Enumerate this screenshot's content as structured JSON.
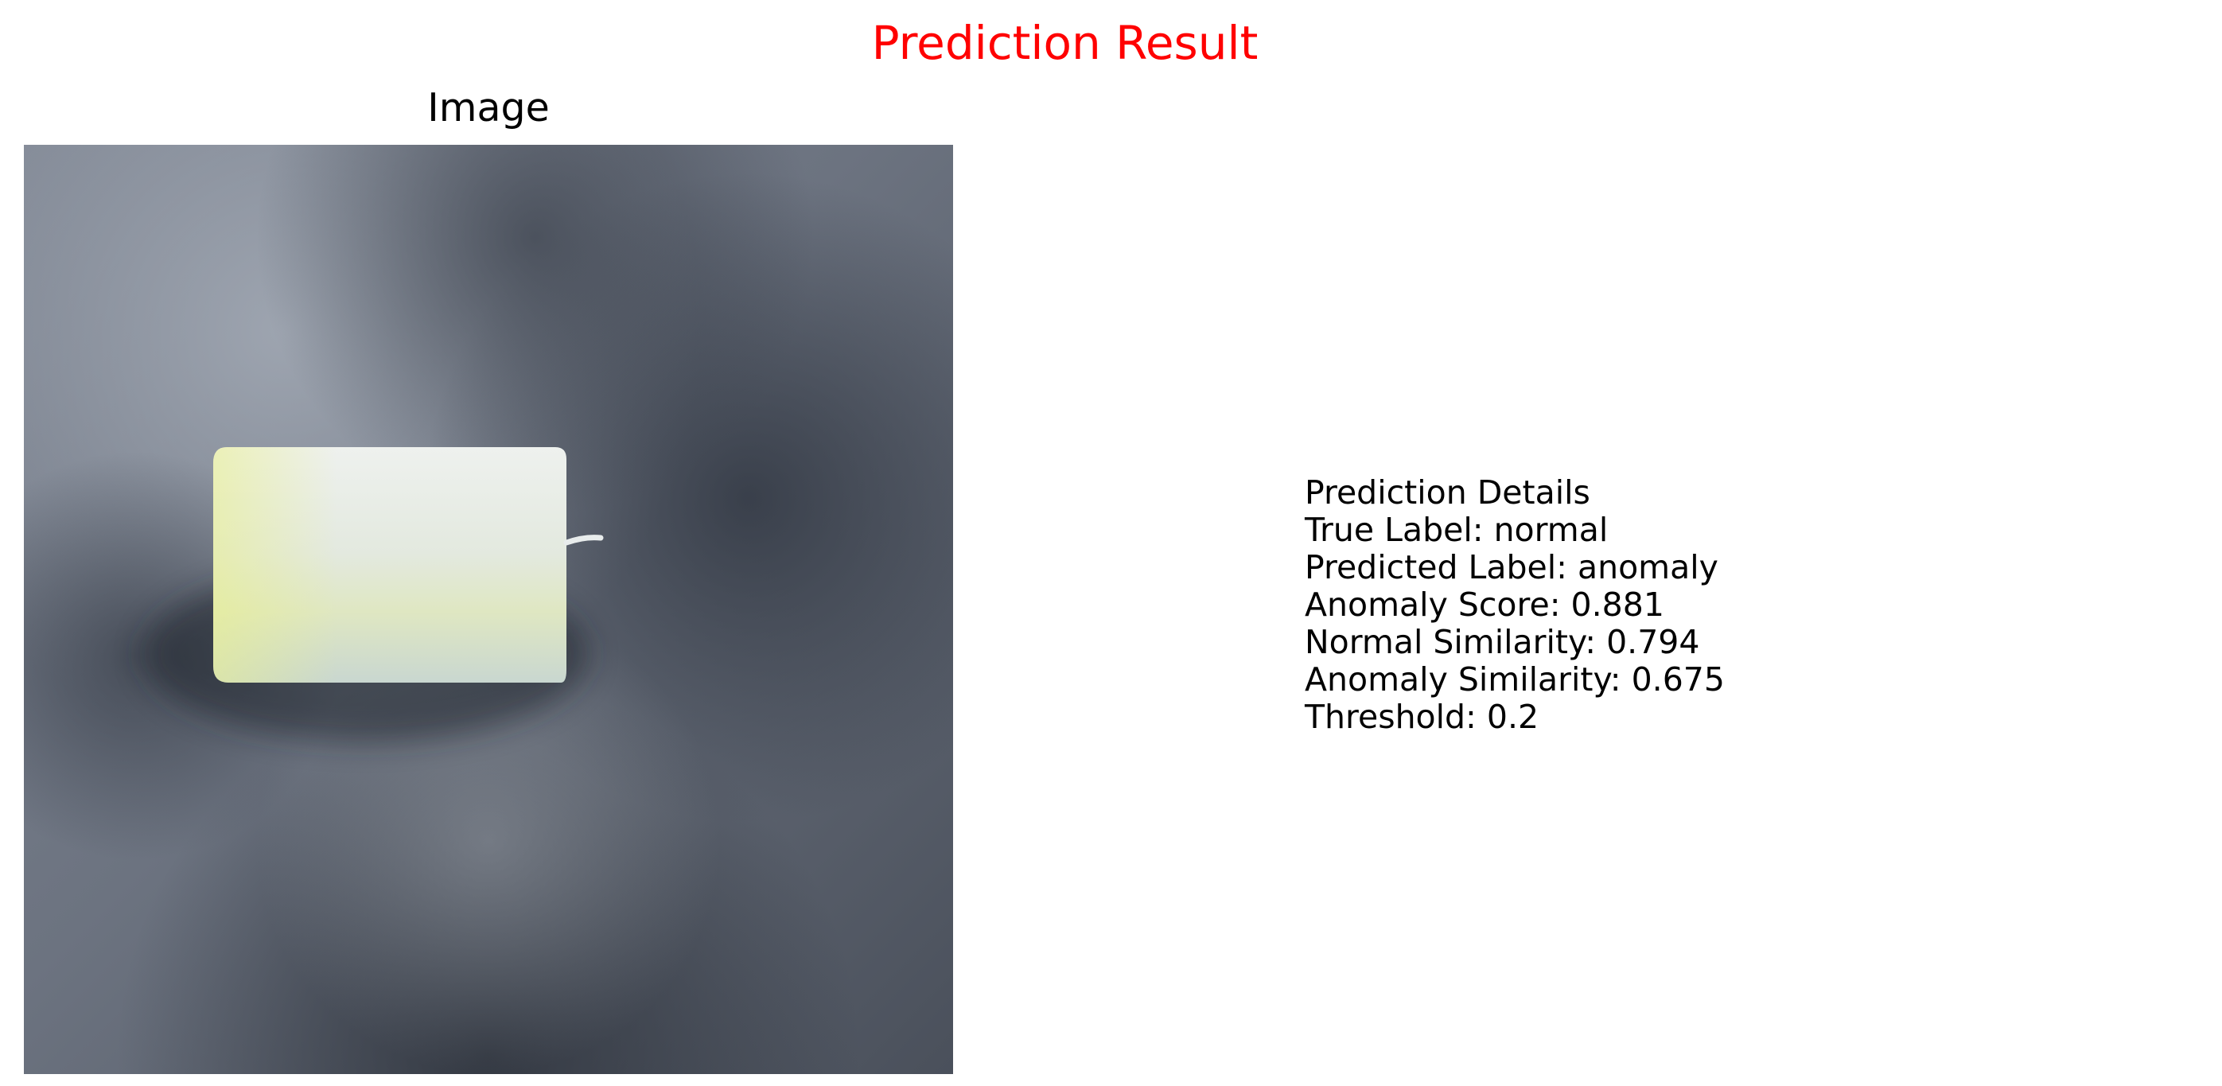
{
  "figure": {
    "title": "Prediction Result",
    "title_color": "#ff0000"
  },
  "image_panel": {
    "title": "Image",
    "photo_subject": "white cylindrical candle on dark gray plush blanket"
  },
  "details": {
    "heading": "Prediction Details",
    "true_label": "True Label: normal",
    "predicted_label": "Predicted Label: anomaly",
    "anomaly_score": "Anomaly Score: 0.881",
    "normal_similarity": "Normal Similarity: 0.794",
    "anomaly_similarity": "Anomaly Similarity: 0.675",
    "threshold": "Threshold: 0.2"
  },
  "colors": {
    "title": "#ff0000",
    "text": "#000000",
    "background": "#ffffff",
    "blanket_light": "#8e96a3",
    "blanket_dark": "#3c4350",
    "candle": "#e4ebe2"
  }
}
